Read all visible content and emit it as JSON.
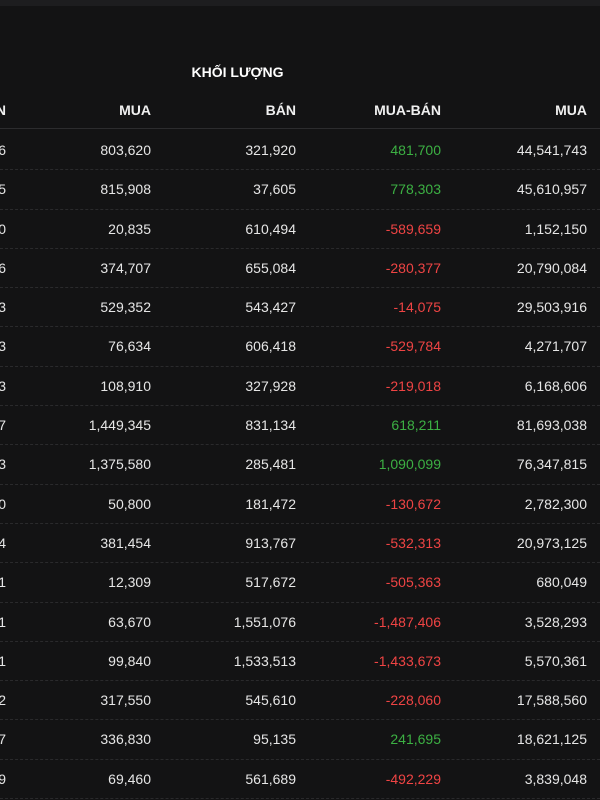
{
  "group_header": "KHỐI LƯỢNG",
  "columns": [
    "N",
    "MUA",
    "BÁN",
    "MUA-BÁN",
    "MUA"
  ],
  "colors": {
    "positive": "#3cb043",
    "negative": "#ef4444",
    "background": "#131314"
  },
  "rows": [
    {
      "c0": "6",
      "mua": "803,620",
      "ban": "321,920",
      "net": "481,700",
      "sign": "pos",
      "mua2": "44,541,743"
    },
    {
      "c0": "5",
      "mua": "815,908",
      "ban": "37,605",
      "net": "778,303",
      "sign": "pos",
      "mua2": "45,610,957"
    },
    {
      "c0": "0",
      "mua": "20,835",
      "ban": "610,494",
      "net": "-589,659",
      "sign": "neg",
      "mua2": "1,152,150"
    },
    {
      "c0": "6",
      "mua": "374,707",
      "ban": "655,084",
      "net": "-280,377",
      "sign": "neg",
      "mua2": "20,790,084"
    },
    {
      "c0": "3",
      "mua": "529,352",
      "ban": "543,427",
      "net": "-14,075",
      "sign": "neg",
      "mua2": "29,503,916"
    },
    {
      "c0": "3",
      "mua": "76,634",
      "ban": "606,418",
      "net": "-529,784",
      "sign": "neg",
      "mua2": "4,271,707"
    },
    {
      "c0": "3",
      "mua": "108,910",
      "ban": "327,928",
      "net": "-219,018",
      "sign": "neg",
      "mua2": "6,168,606"
    },
    {
      "c0": "7",
      "mua": "1,449,345",
      "ban": "831,134",
      "net": "618,211",
      "sign": "pos",
      "mua2": "81,693,038"
    },
    {
      "c0": "3",
      "mua": "1,375,580",
      "ban": "285,481",
      "net": "1,090,099",
      "sign": "pos",
      "mua2": "76,347,815"
    },
    {
      "c0": "0",
      "mua": "50,800",
      "ban": "181,472",
      "net": "-130,672",
      "sign": "neg",
      "mua2": "2,782,300"
    },
    {
      "c0": "4",
      "mua": "381,454",
      "ban": "913,767",
      "net": "-532,313",
      "sign": "neg",
      "mua2": "20,973,125"
    },
    {
      "c0": "1",
      "mua": "12,309",
      "ban": "517,672",
      "net": "-505,363",
      "sign": "neg",
      "mua2": "680,049"
    },
    {
      "c0": "1",
      "mua": "63,670",
      "ban": "1,551,076",
      "net": "-1,487,406",
      "sign": "neg",
      "mua2": "3,528,293"
    },
    {
      "c0": "1",
      "mua": "99,840",
      "ban": "1,533,513",
      "net": "-1,433,673",
      "sign": "neg",
      "mua2": "5,570,361"
    },
    {
      "c0": "2",
      "mua": "317,550",
      "ban": "545,610",
      "net": "-228,060",
      "sign": "neg",
      "mua2": "17,588,560"
    },
    {
      "c0": "7",
      "mua": "336,830",
      "ban": "95,135",
      "net": "241,695",
      "sign": "pos",
      "mua2": "18,621,125"
    },
    {
      "c0": "9",
      "mua": "69,460",
      "ban": "561,689",
      "net": "-492,229",
      "sign": "neg",
      "mua2": "3,839,048"
    }
  ]
}
